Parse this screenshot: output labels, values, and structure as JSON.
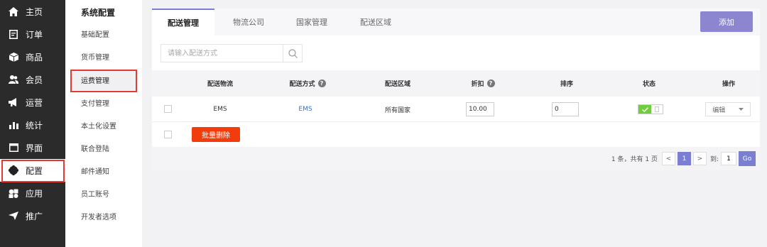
{
  "nav": {
    "items": [
      {
        "label": "主页",
        "icon": "home-icon"
      },
      {
        "label": "订单",
        "icon": "orders-icon"
      },
      {
        "label": "商品",
        "icon": "box-icon"
      },
      {
        "label": "会员",
        "icon": "members-icon"
      },
      {
        "label": "运营",
        "icon": "megaphone-icon"
      },
      {
        "label": "统计",
        "icon": "bar-chart-icon"
      },
      {
        "label": "界面",
        "icon": "window-icon"
      },
      {
        "label": "配置",
        "icon": "gear-icon"
      },
      {
        "label": "应用",
        "icon": "apps-icon"
      },
      {
        "label": "推广",
        "icon": "send-icon"
      }
    ]
  },
  "subnav": {
    "title": "系统配置",
    "items": [
      "基础配置",
      "货币管理",
      "运费管理",
      "支付管理",
      "本土化设置",
      "联合登陆",
      "邮件通知",
      "员工账号",
      "开发者选项"
    ]
  },
  "tabs": [
    "配送管理",
    "物流公司",
    "国家管理",
    "配送区域"
  ],
  "toolbar": {
    "add_label": "添加"
  },
  "search": {
    "placeholder": "请输入配送方式"
  },
  "table": {
    "headers": [
      "配送物流",
      "配送方式",
      "配送区域",
      "折扣",
      "排序",
      "状态",
      "操作"
    ],
    "rows": [
      {
        "logistics": "EMS",
        "method": "EMS",
        "region": "所有国家",
        "discount": "10.00",
        "sort": "0",
        "status_on": "✓",
        "action": "编辑"
      }
    ]
  },
  "batch": {
    "delete_label": "批量删除"
  },
  "pager": {
    "summary": "1 条，共有 1 页",
    "prev": "<",
    "current": "1",
    "next": ">",
    "goto_label": "到:",
    "goto_value": "1",
    "go_label": "Go"
  },
  "colors": {
    "accent": "#7b7fd1",
    "danger": "#f33c0c",
    "nav_bg": "#2b2b2b",
    "toggle_on": "#6fce3a"
  }
}
